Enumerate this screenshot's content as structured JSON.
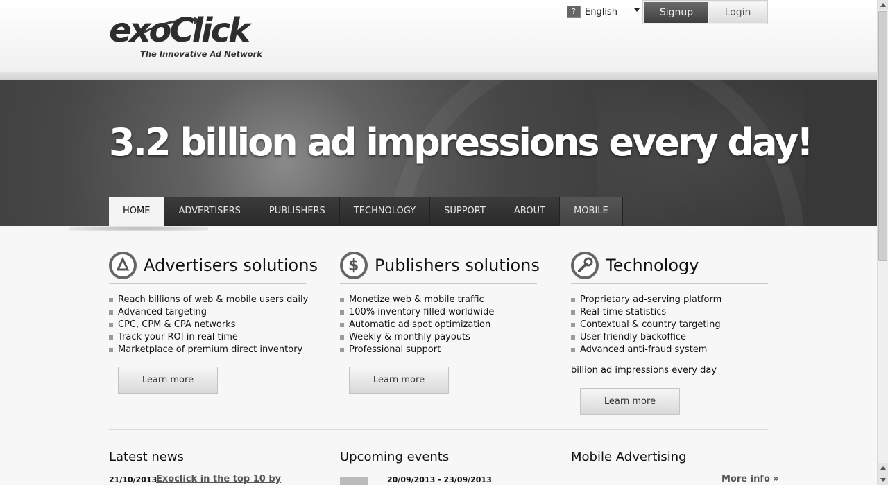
{
  "header": {
    "logo_text": "exoClick",
    "tagline": "The Innovative Ad Network",
    "language": "English",
    "signup_label": "Signup",
    "login_label": "Login"
  },
  "hero": {
    "title": "3.2 billion ad impressions every day!"
  },
  "nav": {
    "items": [
      {
        "label": "HOME"
      },
      {
        "label": "ADVERTISERS"
      },
      {
        "label": "PUBLISHERS"
      },
      {
        "label": "TECHNOLOGY"
      },
      {
        "label": "SUPPORT"
      },
      {
        "label": "ABOUT"
      },
      {
        "label": "MOBILE"
      }
    ]
  },
  "columns": [
    {
      "title": "Advertisers solutions",
      "icon": "advertisers-icon",
      "items": [
        "Reach billions of web & mobile users daily",
        "Advanced targeting",
        "CPC, CPM & CPA networks",
        "Track your ROI in real time",
        "Marketplace of premium direct inventory"
      ],
      "button": "Learn more"
    },
    {
      "title": "Publishers solutions",
      "icon": "dollar-icon",
      "items": [
        "Monetize web & mobile traffic",
        "100% inventory filled worldwide",
        "Automatic ad spot optimization",
        "Weekly & monthly payouts",
        "Professional support"
      ],
      "button": "Learn more"
    },
    {
      "title": "Technology",
      "icon": "wrench-icon",
      "items": [
        "Proprietary ad-serving platform",
        "Real-time statistics",
        "Contextual & country targeting",
        "User-friendly backoffice",
        "Advanced anti-fraud system"
      ],
      "note": "billion ad impressions every day",
      "button": "Learn more"
    }
  ],
  "bottom": {
    "latest_news": "Latest news",
    "news_date": "21/10/2013",
    "news_link": "Exoclick in the top 10 by",
    "upcoming_events": "Upcoming events",
    "event_date": "20/09/2013 - 23/09/2013",
    "mobile_advertising": "Mobile Advertising",
    "more_info": "More info »"
  },
  "colors": {
    "hero_dark": "#383838",
    "nav_active": "#f4f4f4",
    "signup_bg": "#4f4f4f",
    "page_bg": "#f7f7f7"
  }
}
